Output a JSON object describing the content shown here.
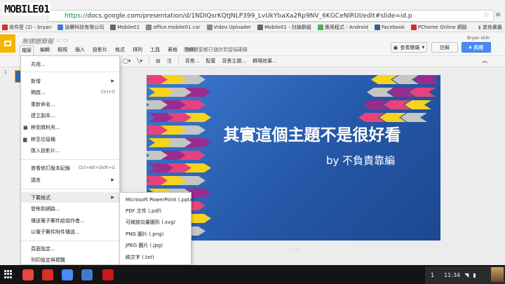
{
  "watermark": {
    "text": "MOBILE01"
  },
  "browser": {
    "url_prefix": "https://",
    "url_rest": "docs.google.com/presentation/d/1NDIQsrKQtJNLP399_LvUkYbaXa2Rp9NV_6KGCeNIRUI/edit#slide=id.p",
    "star_icon": "star-icon",
    "menu_icon": "hamburger-icon"
  },
  "bookmarks": {
    "items": [
      {
        "label": "收件匣 (2) - bryan",
        "icon": "gmail-icon",
        "color": "#d93025"
      },
      {
        "label": "詠勝科技有限公司",
        "icon": "calendar-icon",
        "color": "#3d7ad0"
      },
      {
        "label": "Mobile01",
        "icon": "mobile01-icon",
        "color": "#666666"
      },
      {
        "label": "office.mobile01.cor",
        "icon": "page-icon",
        "color": "#888888"
      },
      {
        "label": "Video Uploader",
        "icon": "page-icon",
        "color": "#888888"
      },
      {
        "label": "Mobile01 - 討論群組",
        "icon": "mobile01-icon",
        "color": "#666666"
      },
      {
        "label": "應用程式 - Android",
        "icon": "play-icon",
        "color": "#4caf50"
      },
      {
        "label": "Facebook",
        "icon": "facebook-icon",
        "color": "#3b5998"
      },
      {
        "label": "PChome Online 網路",
        "icon": "pchome-icon",
        "color": "#d32f2f"
      }
    ],
    "other": "其他書籤"
  },
  "app": {
    "title": "無標題簡報",
    "user": "Bryan shih",
    "menus": [
      "檔案",
      "編輯",
      "檢視",
      "插入",
      "投影片",
      "格式",
      "排列",
      "工具",
      "表格",
      "說明"
    ],
    "saved_message": "所有變更都已儲存到雲端硬碟",
    "present_label": "查看簡報",
    "comments_label": "註解",
    "share_label": "共用"
  },
  "toolbar": {
    "items": [
      "注",
      "背景...",
      "配置",
      "背景主題...",
      "轉場效果..."
    ]
  },
  "filmstrip": {
    "slide_number": "1"
  },
  "slide": {
    "title": "其實這個主題不是很好看",
    "subtitle": "by 不負責靠編"
  },
  "file_menu": {
    "share": "共用...",
    "new": "新增",
    "open": "開啟...",
    "open_shortcut": "Ctrl+O",
    "rename": "重新命名...",
    "copy": "建立副本...",
    "move": "移到資料夾...",
    "trash": "移至垃圾桶",
    "import": "匯入投影片...",
    "revisions": "查看修訂版本紀錄",
    "revisions_shortcut": "Ctrl+Alt+Shift+G",
    "language": "語言",
    "download": "下載格式",
    "publish": "發佈到網路...",
    "email_collab": "傳送電子郵件給協作者...",
    "email_attach": "以電子郵件附件傳送...",
    "page_setup": "頁面設定...",
    "print_preview": "列印設定與預覽"
  },
  "download_submenu": [
    "Microsoft PowerPoint (.pptx)",
    "PDF 文件 (.pdf)",
    "可縮放向量圖形 (.svg)",
    "PNG 圖片 (.png)",
    "JPEG 圖片 (.jpg)",
    "純文字 (.txt)"
  ],
  "taskbar": {
    "apps": [
      {
        "name": "chrome-icon",
        "color": "#e8453c"
      },
      {
        "name": "gmail-icon",
        "color": "#d93025"
      },
      {
        "name": "google-search-icon",
        "color": "#4a8af4"
      },
      {
        "name": "docs-icon",
        "color": "#3d7ad0"
      },
      {
        "name": "youtube-icon",
        "color": "#cc181e"
      }
    ],
    "badge": "1",
    "time": "11:34"
  },
  "colors": {
    "accent": "#4a8af4",
    "slides_logo": "#f4b400",
    "slide_bg": "#2558a8"
  }
}
